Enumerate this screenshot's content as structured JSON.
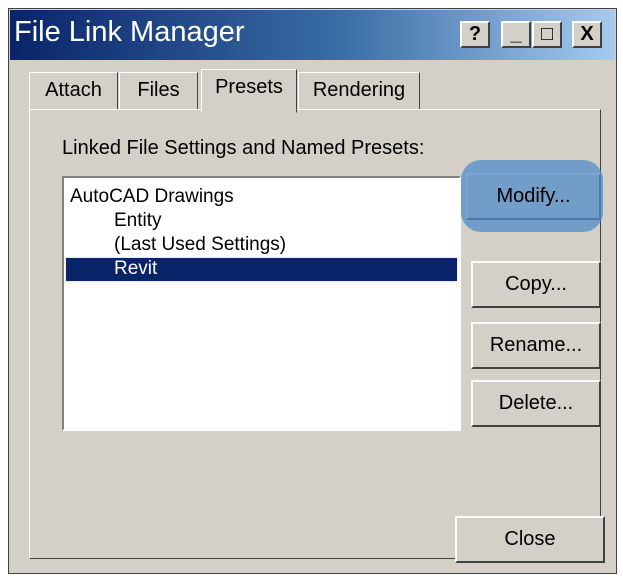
{
  "window": {
    "title": "File Link Manager",
    "controls": {
      "help": "?",
      "minimize": "_",
      "maximize": "□",
      "close": "X"
    }
  },
  "tabs": [
    {
      "label": "Attach",
      "active": false
    },
    {
      "label": "Files",
      "active": false
    },
    {
      "label": "Presets",
      "active": true
    },
    {
      "label": "Rendering",
      "active": false
    }
  ],
  "presets": {
    "section_label": "Linked File Settings and Named Presets:",
    "list": [
      {
        "label": "AutoCAD Drawings",
        "level": 0,
        "selected": false
      },
      {
        "label": "Entity",
        "level": 1,
        "selected": false
      },
      {
        "label": "(Last Used Settings)",
        "level": 1,
        "selected": false
      },
      {
        "label": "Revit",
        "level": 1,
        "selected": true
      }
    ],
    "buttons": {
      "modify": "Modify...",
      "copy": "Copy...",
      "rename": "Rename...",
      "delete": "Delete..."
    }
  },
  "footer": {
    "close": "Close"
  },
  "colors": {
    "titlebar_start": "#0a246a",
    "titlebar_end": "#a6caf0",
    "selection": "#0a246a",
    "face": "#d4d0c8",
    "highlight": "#528cc8"
  }
}
